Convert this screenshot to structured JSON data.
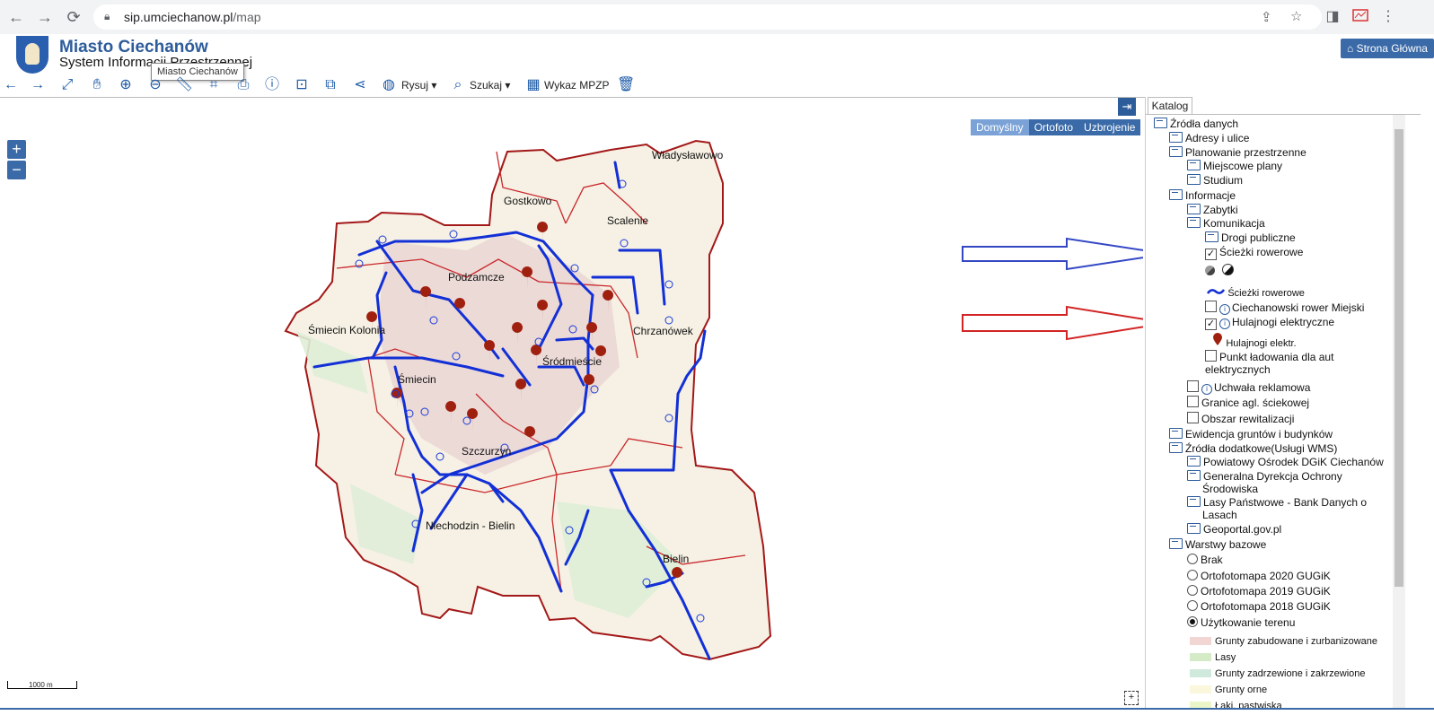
{
  "browser": {
    "url_domain": "sip.umciechanow.pl",
    "url_path": "/map",
    "nav_back": "←",
    "nav_forward": "→",
    "reload": "⟳"
  },
  "header": {
    "title": "Miasto Ciechanów",
    "subtitle": "System Informacji Przestrzennej",
    "tooltip": "Miasto Ciechanów",
    "home_button": "Strona Główna"
  },
  "toolbar": {
    "draw_label": "Rysuj",
    "search_label": "Szukaj",
    "mpzp_label": "Wykaz MPZP"
  },
  "map": {
    "zoom_in": "+",
    "zoom_out": "−",
    "basemaps": [
      "Domyślny",
      "Ortofoto",
      "Uzbrojenie"
    ],
    "scale": "1000 m",
    "places": [
      "Władysławowo",
      "Gostkowo",
      "Scalenie",
      "Podzamcze",
      "Śmiecin Kolonia",
      "Chrzanówek",
      "Śródmieście",
      "Śmiecin",
      "Szczurzyn",
      "Niechodzin - Bielin",
      "Bielin"
    ]
  },
  "catalog": {
    "tab": "Katalog",
    "nodes": {
      "zrodla": "Źródła danych",
      "adresy": "Adresy i ulice",
      "planowanie": "Planowanie przestrzenne",
      "miejscowe": "Miejscowe plany",
      "studium": "Studium",
      "informacje": "Informacje",
      "zabytki": "Zabytki",
      "komunikacja": "Komunikacja",
      "drogi": "Drogi publiczne",
      "sciezki": "Ścieżki rowerowe",
      "sciezki_legend": "Ścieżki rowerowe",
      "rower_miejski": "Ciechanowski rower Miejski",
      "hulajnogi": "Hulajnogi elektryczne",
      "hulajnogi_legend": "Hulajnogi elektr.",
      "punkt_1": "Punkt ładowania dla aut",
      "punkt_2": "elektrycznych",
      "uchwala": "Uchwała reklamowa",
      "granice": "Granice agl. ściekowej",
      "obszar": "Obszar rewitalizacji",
      "ewidencja": "Ewidencja gruntów i budynków",
      "dodatkowe": "Źródła dodatkowe(Usługi WMS)",
      "powiatowy": "Powiatowy Ośrodek DGiK Ciechanów",
      "gdos_1": "Generalna Dyrekcja Ochrony",
      "gdos_2": "Środowiska",
      "lasy_1": "Lasy Państwowe - Bank Danych o",
      "lasy_2": "Lasach",
      "geoportal": "Geoportal.gov.pl",
      "warstwy": "Warstwy bazowe",
      "brak": "Brak",
      "orto2020": "Ortofotomapa 2020 GUGiK",
      "orto2019": "Ortofotomapa 2019 GUGiK",
      "orto2018": "Ortofotomapa 2018 GUGiK",
      "uzytkowanie": "Użytkowanie terenu",
      "leg_zabud": "Grunty zabudowane i zurbanizowane",
      "leg_lasy": "Lasy",
      "leg_zadrz": "Grunty zadrzewione i zakrzewione",
      "leg_orne": "Grunty orne",
      "leg_laki": "Łąki, pastwiska"
    }
  },
  "colors": {
    "brand": "#2d5c9b",
    "bike_path": "#1330d6",
    "boundary": "#b21c1c",
    "arrow_blue": "#3347c4",
    "arrow_red": "#d22424",
    "scooter_pin": "#a02010"
  }
}
